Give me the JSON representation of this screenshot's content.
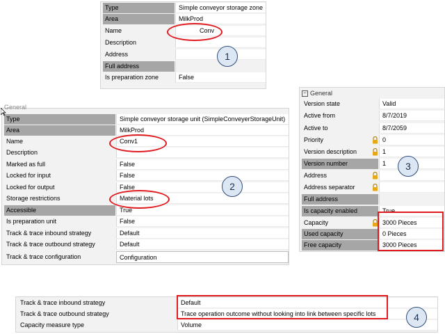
{
  "panel1": {
    "rows": [
      {
        "key": "Type",
        "value": "Simple conveyor storage zone",
        "grey": true
      },
      {
        "key": "Area",
        "value": "MilkProd",
        "grey": true
      },
      {
        "key": "Name",
        "value": "Conv",
        "grey": false
      },
      {
        "key": "Description",
        "value": "",
        "grey": false
      },
      {
        "key": "Address",
        "value": "",
        "grey": false
      },
      {
        "key": "Full address",
        "value": "",
        "grey": true
      },
      {
        "key": "Is preparation zone",
        "value": "False",
        "grey": false
      }
    ],
    "badge": "1"
  },
  "panel2": {
    "section": "General",
    "rows": [
      {
        "key": "Type",
        "value": "Simple conveyor storage unit (SimpleConveyerStorageUnit)",
        "grey": true
      },
      {
        "key": "Area",
        "value": "MilkProd",
        "grey": true
      },
      {
        "key": "Name",
        "value": "Conv1",
        "grey": false
      },
      {
        "key": "Description",
        "value": "",
        "grey": false
      },
      {
        "key": "Marked as full",
        "value": "False",
        "grey": false
      },
      {
        "key": "Locked for input",
        "value": "False",
        "grey": false
      },
      {
        "key": "Locked for output",
        "value": "False",
        "grey": false
      },
      {
        "key": "Storage restrictions",
        "value": "Material lots",
        "grey": false
      },
      {
        "key": "Accessible",
        "value": "True",
        "grey": true
      },
      {
        "key": "Is preparation unit",
        "value": "False",
        "grey": false
      },
      {
        "key": "Track & trace inbound strategy",
        "value": "Default",
        "grey": false
      },
      {
        "key": "Track & trace outbound strategy",
        "value": "Default",
        "grey": false
      },
      {
        "key": "Track & trace configuration",
        "value": "Configuration",
        "grey": false
      }
    ],
    "badge": "2"
  },
  "panel3": {
    "section": "General",
    "rows": [
      {
        "key": "Version state",
        "value": "Valid",
        "grey": false,
        "lock": false
      },
      {
        "key": "Active from",
        "value": "8/7/2019",
        "grey": false,
        "lock": false
      },
      {
        "key": "Active to",
        "value": "8/7/2059",
        "grey": false,
        "lock": false
      },
      {
        "key": "Priority",
        "value": "0",
        "grey": false,
        "lock": true
      },
      {
        "key": "Version description",
        "value": "1",
        "grey": false,
        "lock": true
      },
      {
        "key": "Version number",
        "value": "1",
        "grey": true,
        "lock": false
      },
      {
        "key": "Address",
        "value": "",
        "grey": false,
        "lock": true
      },
      {
        "key": "Address separator",
        "value": "",
        "grey": false,
        "lock": true
      },
      {
        "key": "Full address",
        "value": "",
        "grey": true,
        "lock": false
      },
      {
        "key": "Is capacity enabled",
        "value": "True",
        "grey": true,
        "lock": false
      },
      {
        "key": "Capacity",
        "value": "3000 Pieces",
        "grey": false,
        "lock": true
      },
      {
        "key": "Used capacity",
        "value": "0 Pieces",
        "grey": true,
        "lock": false
      },
      {
        "key": "Free capacity",
        "value": "3000 Pieces",
        "grey": true,
        "lock": false
      }
    ],
    "badge": "3"
  },
  "panel4": {
    "rows": [
      {
        "key": "Track & trace inbound strategy",
        "value": "Default"
      },
      {
        "key": "Track & trace outbound strategy",
        "value": "Trace operation outcome without looking into link between specific lots"
      },
      {
        "key": "Capacity measure type",
        "value": "Volume"
      }
    ],
    "badge": "4"
  },
  "colors": {
    "highlight": "#e0191f",
    "grey_key": "#a6a6a6",
    "badge_fill": "#dde6f3",
    "lock": "#e6a817"
  }
}
